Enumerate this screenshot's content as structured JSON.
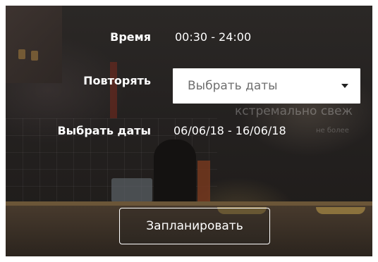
{
  "form": {
    "time_label": "Время",
    "time_value": "00:30 - 24:00",
    "repeat_label": "Повторять",
    "repeat_select": {
      "selected": "Выбрать даты"
    },
    "dates_label": "Выбрать даты",
    "dates_value": "06/06/18  - 16/06/18",
    "submit_label": "Запланировать"
  },
  "colors": {
    "text": "#ffffff",
    "select_background": "#ffffff",
    "select_text": "#6f6f6f",
    "button_border": "#ffffff"
  },
  "icons": {
    "select_arrow": "chevron-down-icon"
  }
}
